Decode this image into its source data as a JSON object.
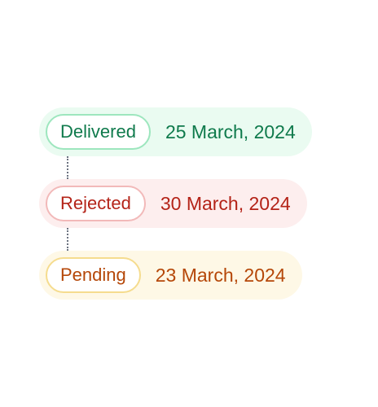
{
  "timeline": [
    {
      "status": "Delivered",
      "date": "25 March, 2024",
      "colors": {
        "row_bg": "#EAFBF1",
        "pill_border": "#9DE6BE",
        "text": "#0F7A4C"
      }
    },
    {
      "status": "Rejected",
      "date": "30 March, 2024",
      "colors": {
        "row_bg": "#FDEEEE",
        "pill_border": "#F2B9B9",
        "text": "#B42318"
      }
    },
    {
      "status": "Pending",
      "date": "23 March, 2024",
      "colors": {
        "row_bg": "#FEF8E6",
        "pill_border": "#F5DC8E",
        "text": "#B54708"
      }
    }
  ]
}
